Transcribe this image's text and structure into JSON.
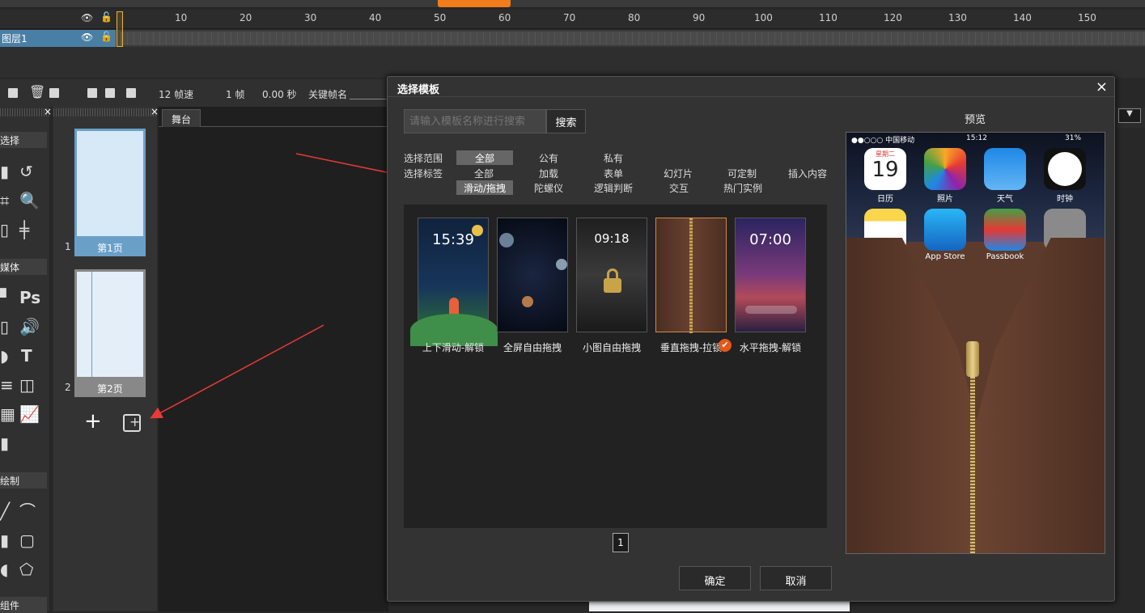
{
  "timeline": {
    "ruler_ticks": [
      "10",
      "20",
      "30",
      "40",
      "50",
      "60",
      "70",
      "80",
      "90",
      "100",
      "110",
      "120",
      "130",
      "140",
      "150"
    ],
    "layer_name": "图层1"
  },
  "toolbar": {
    "fps": "12 帧速",
    "frame": "1 帧",
    "seconds": "0.00 秒",
    "keyframe_name_label": "关键帧名"
  },
  "tools_panel": {
    "section_select": "选择",
    "section_media": "媒体",
    "section_draw": "绘制",
    "section_components": "组件"
  },
  "pages": [
    {
      "num": "1",
      "label": "第1页"
    },
    {
      "num": "2",
      "label": "第2页"
    }
  ],
  "stage": {
    "tab": "舞台"
  },
  "dialog": {
    "title": "选择模板",
    "close": "×",
    "search_placeholder": "请输入模板名称进行搜索",
    "search_button": "搜索",
    "scope_label": "选择范围",
    "scope_options": [
      "全部",
      "公有",
      "私有"
    ],
    "tag_label": "选择标签",
    "tag_row1": [
      "全部",
      "加载",
      "表单",
      "幻灯片",
      "可定制",
      "插入内容"
    ],
    "tag_row2": [
      "滑动/拖拽",
      "陀螺仪",
      "逻辑判断",
      "交互",
      "热门实例"
    ],
    "templates": [
      {
        "name": "上下滑动-解锁",
        "time": "15:39"
      },
      {
        "name": "全屏自由拖拽",
        "time": ""
      },
      {
        "name": "小图自由拖拽",
        "time": "09:18"
      },
      {
        "name": "垂直拖拽-拉锁",
        "time": ""
      },
      {
        "name": "水平拖拽-解锁",
        "time": "07:00"
      }
    ],
    "selected_badge": "✔",
    "page": "1",
    "preview_title": "预览",
    "preview": {
      "carrier": "●●○○○ 中国移动",
      "time": "15:12",
      "battery": "31%",
      "calendar_day": "19",
      "calendar_weekday": "星期二",
      "apps": [
        "日历",
        "照片",
        "天气",
        "时钟",
        "App Store",
        "Passbook"
      ]
    },
    "confirm": "确定",
    "cancel": "取消"
  }
}
